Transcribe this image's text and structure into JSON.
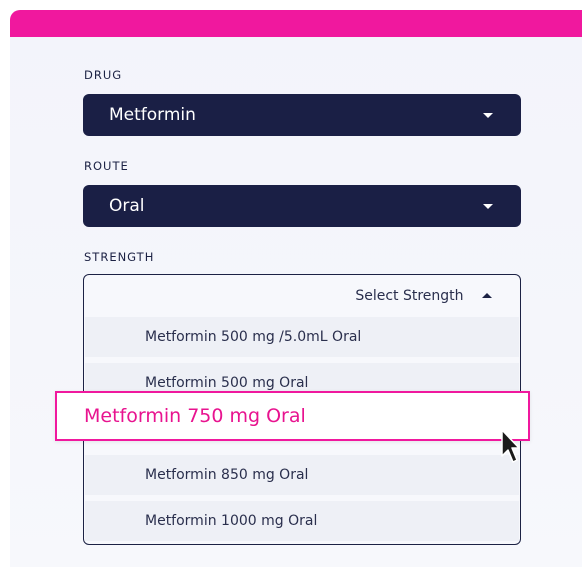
{
  "colors": {
    "accent": "#f0189e",
    "navy": "#1a1f45",
    "background": "#f4f5fb"
  },
  "drug": {
    "label": "DRUG",
    "value": "Metformin"
  },
  "route": {
    "label": "ROUTE",
    "value": "Oral"
  },
  "strength": {
    "label": "STRENGTH",
    "placeholder": "Select Strength",
    "options": [
      "Metformin 500 mg /5.0mL Oral",
      "Metformin 500 mg Oral",
      "Metformin 750 mg Oral",
      "Metformin 850 mg Oral",
      "Metformin 1000 mg Oral"
    ],
    "highlighted_index": 2
  },
  "icons": {
    "dropdown_caret": "chevron-down-icon",
    "collapse_caret": "chevron-up-icon",
    "cursor": "mouse-pointer-icon"
  }
}
